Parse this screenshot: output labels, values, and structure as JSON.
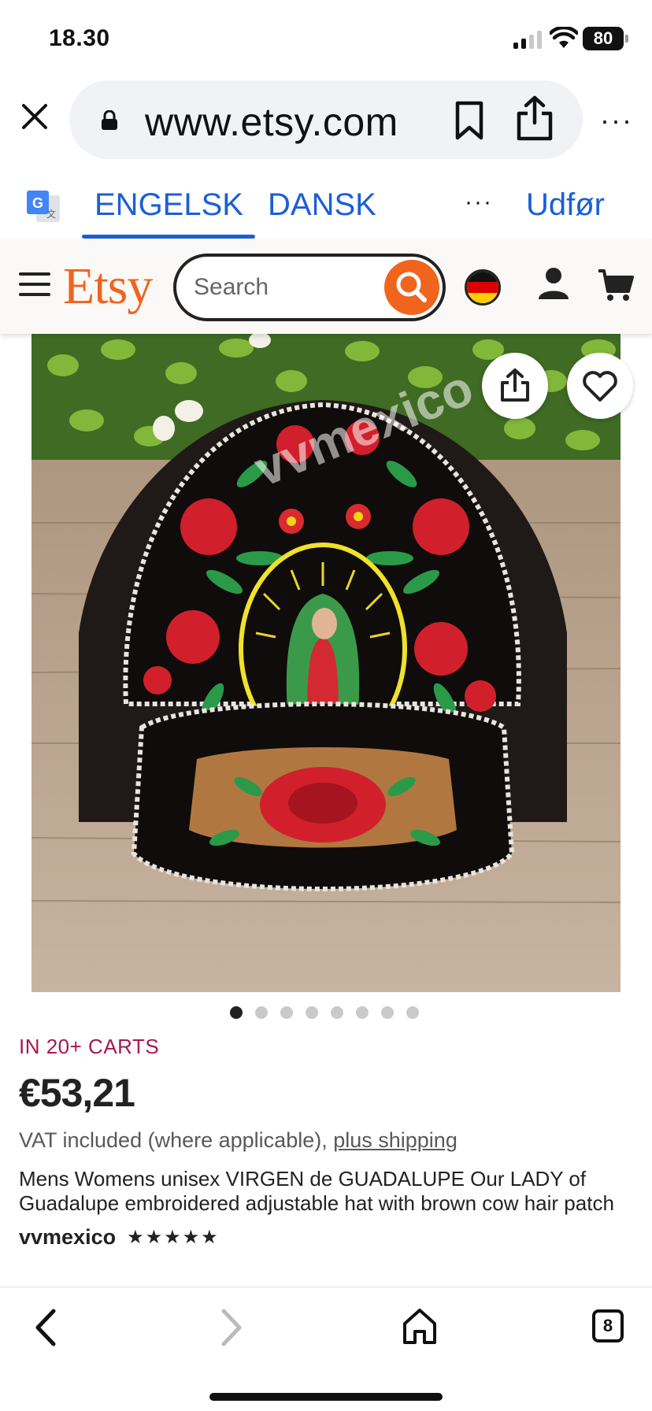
{
  "status_bar": {
    "time": "18.30",
    "battery": "80"
  },
  "browser": {
    "url": "www.etsy.com",
    "translate": {
      "source_lang": "ENGELSK",
      "target_lang": "DANSK",
      "more": "···",
      "done": "Udfør"
    },
    "more": "···"
  },
  "etsy": {
    "logo": "Etsy",
    "search_placeholder": "Search"
  },
  "product": {
    "image_watermark": "vvmexico",
    "image_count": 8,
    "active_image": 1,
    "carts": "IN 20+ CARTS",
    "price": "€53,21",
    "vat_text": "VAT included (where applicable), ",
    "shipping_link": "plus shipping",
    "title": "Mens Womens unisex VIRGEN de GUADALUPE Our LADY of Guadalupe embroidered adjustable hat with brown cow hair patch",
    "shop_name": "vvmexico",
    "rating_stars": "★★★★★"
  },
  "bottom_nav": {
    "tab_count": "8"
  },
  "colors": {
    "etsy_orange": "#f1641e",
    "link_blue": "#1a5fd6",
    "carts_red": "#a61a4a"
  }
}
